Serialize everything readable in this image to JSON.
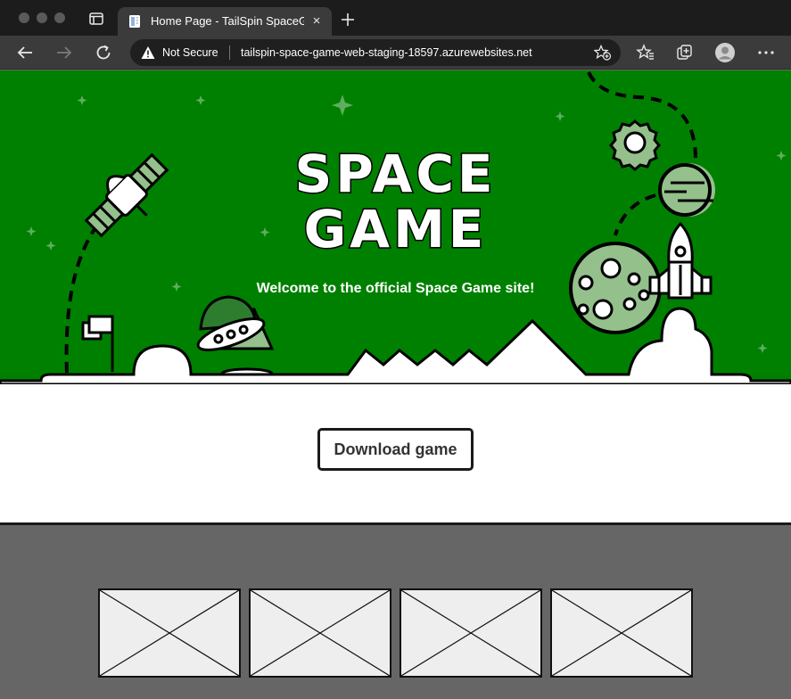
{
  "browser": {
    "tab": {
      "title": "Home Page - TailSpin SpaceGame",
      "close": "×"
    },
    "address": {
      "security": "Not Secure",
      "url": "tailspin-space-game-web-staging-18597.azurewebsites.net"
    }
  },
  "hero": {
    "title_line1": "SPACE",
    "title_line2": "GAME",
    "welcome": "Welcome to the official Space Game site!"
  },
  "main": {
    "download_label": "Download game"
  },
  "gallery": {
    "thumbnails": [
      "placeholder-1",
      "placeholder-2",
      "placeholder-3",
      "placeholder-4"
    ]
  },
  "colors": {
    "hero_bg": "#008000",
    "accent_light": "#94c08c",
    "footer_bg": "#666666"
  }
}
